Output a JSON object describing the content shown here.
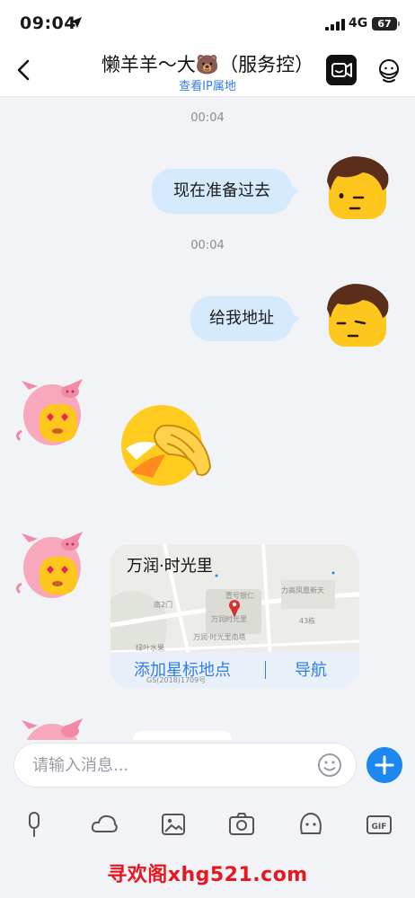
{
  "status_bar": {
    "time": "09:04",
    "network": "4G",
    "battery": "67"
  },
  "header": {
    "title": "懒羊羊～大🐻（服务控）",
    "ip_link": "查看IP属地"
  },
  "messages": [
    {
      "type": "timestamp",
      "text": "00:04"
    },
    {
      "type": "text",
      "side": "right",
      "text": "现在准备过去"
    },
    {
      "type": "timestamp",
      "text": "00:04"
    },
    {
      "type": "text",
      "side": "right",
      "text": "给我地址"
    },
    {
      "type": "sticker",
      "side": "left",
      "icon": "facepalm-emoji"
    },
    {
      "type": "location",
      "side": "left",
      "name": "万润·时光里",
      "fav_label": "添加星标地点",
      "nav_label": "导航",
      "map_labels": [
        "南2门",
        "壹号银仁",
        "万润时光里",
        "力高凤凰新天",
        "43栋",
        "万润·时光里南塔",
        "绿叶水果",
        "GS(2018)1709号"
      ]
    }
  ],
  "input": {
    "placeholder": "请输入消息..."
  },
  "toolbar": [
    "mic-icon",
    "cloud-icon",
    "image-icon",
    "camera-icon",
    "sticker-icon",
    "gif-icon"
  ],
  "watermark": "寻欢阁xhg521.com",
  "colors": {
    "accent": "#1e88f0",
    "bubble": "#d6eafd",
    "link": "#2f7fe8"
  }
}
